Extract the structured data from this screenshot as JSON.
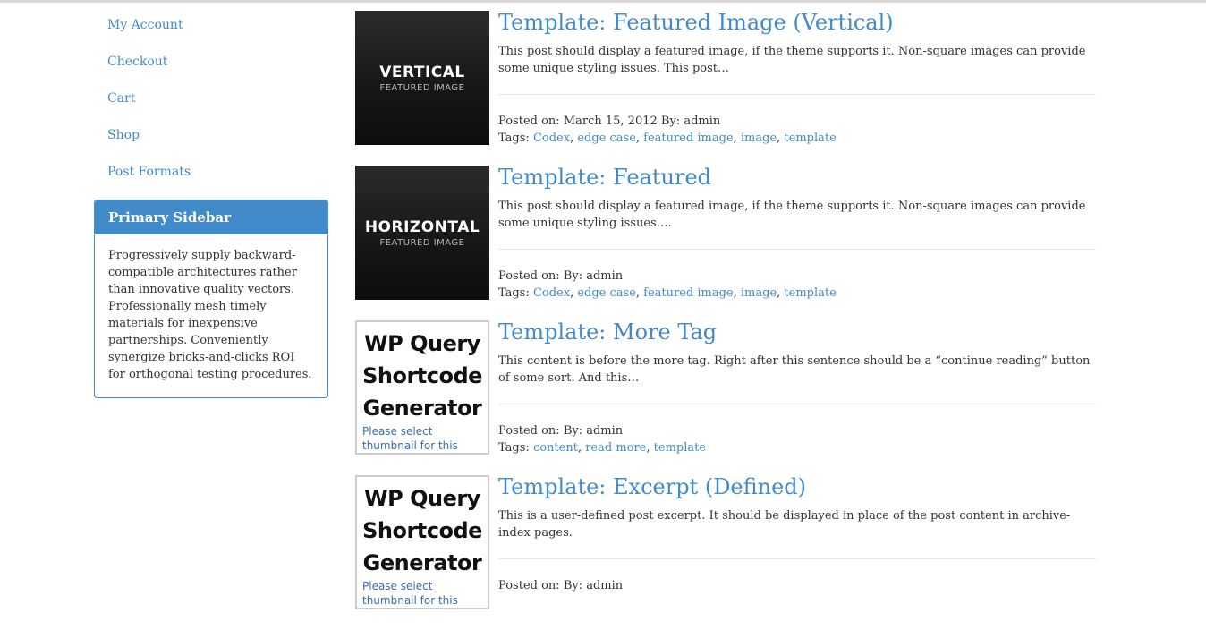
{
  "nav": {
    "items": [
      {
        "label": "My Account"
      },
      {
        "label": "Checkout"
      },
      {
        "label": "Cart"
      },
      {
        "label": "Shop"
      },
      {
        "label": "Post Formats"
      }
    ]
  },
  "widget": {
    "title": "Primary Sidebar",
    "text": "Progressively supply backward-compatible architectures rather than innovative quality vectors. Professionally mesh timely materials for inexpensive partnerships. Conveniently synergize bricks-and-clicks ROI for orthogonal testing procedures."
  },
  "posts": [
    {
      "title": "Template: Featured Image (Vertical)",
      "excerpt": "This post should display a featured image, if the theme supports it. Non-square images can provide some unique styling issues. This post…",
      "posted_prefix": "Posted on:",
      "date": "March 15, 2012",
      "by_prefix": "By:",
      "author": "admin",
      "tags_prefix": "Tags:",
      "tags": [
        "Codex",
        "edge case",
        "featured image",
        "image",
        "template"
      ],
      "thumb": {
        "kind": "dark",
        "big": "VERTICAL",
        "small": "FEATURED IMAGE"
      }
    },
    {
      "title": "Template: Featured",
      "excerpt": "This post should display a featured image, if the theme supports it. Non-square images can provide some unique styling issues.…",
      "posted_prefix": "Posted on:",
      "date": "",
      "by_prefix": "By:",
      "author": "admin",
      "tags_prefix": "Tags:",
      "tags": [
        "Codex",
        "edge case",
        "featured image",
        "image",
        "template"
      ],
      "thumb": {
        "kind": "dark",
        "big": "HORIZONTAL",
        "small": "FEATURED IMAGE"
      }
    },
    {
      "title": "Template: More Tag",
      "excerpt": "This content is before the more tag. Right after this sentence should be a “continue reading” button of some sort. And this…",
      "posted_prefix": "Posted on:",
      "date": "",
      "by_prefix": "By:",
      "author": "admin",
      "tags_prefix": "Tags:",
      "tags": [
        "content",
        "read more",
        "template"
      ],
      "thumb": {
        "kind": "wp",
        "line1": "WP Query",
        "line2": "Shortcode",
        "line3": "Generator",
        "note": "Please select thumbnail for this post"
      }
    },
    {
      "title": "Template: Excerpt (Defined)",
      "excerpt": "This is a user-defined post excerpt. It should be displayed in place of the post content in archive-index pages.",
      "posted_prefix": "Posted on:",
      "date": "",
      "by_prefix": "By:",
      "author": "admin",
      "tags_prefix": "",
      "tags": [],
      "thumb": {
        "kind": "wp",
        "line1": "WP Query",
        "line2": "Shortcode",
        "line3": "Generator",
        "note": "Please select thumbnail for this post"
      }
    }
  ],
  "colors": {
    "link": "#428bca",
    "widget_header": "#428bca",
    "text": "#333333"
  }
}
